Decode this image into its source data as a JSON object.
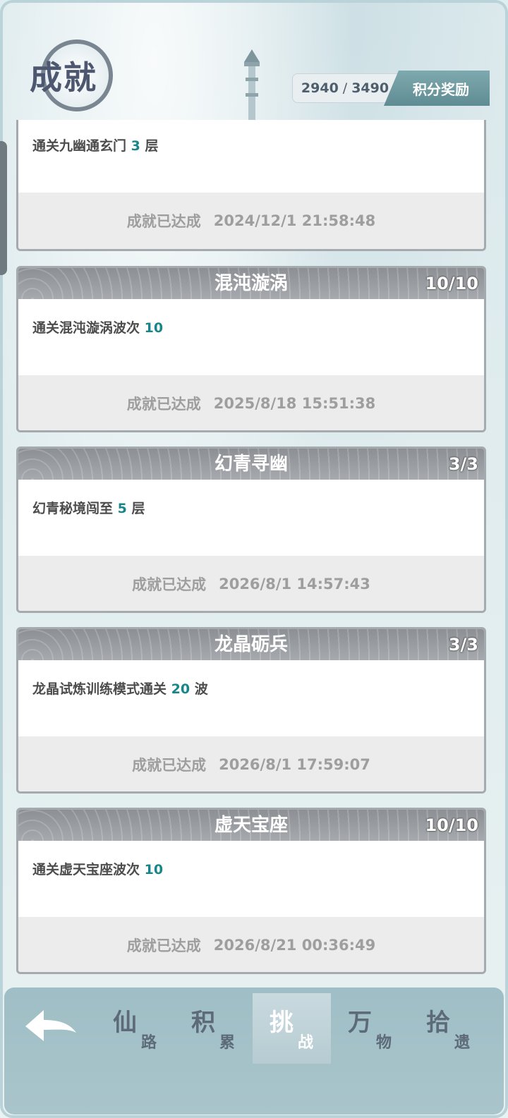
{
  "header": {
    "title": "成就",
    "score_current": "2940",
    "score_sep": "/",
    "score_total": "3490",
    "reward_label": "积分奖励"
  },
  "cards": [
    {
      "title": "",
      "count": "",
      "desc_prefix": "通关九幽通玄门 ",
      "desc_num": "3",
      "desc_suffix": " 层",
      "status": "成就已达成",
      "time": "2024/12/1 21:58:48"
    },
    {
      "title": "混沌漩涡",
      "count": "10/10",
      "desc_prefix": "通关混沌漩涡波次 ",
      "desc_num": "10",
      "desc_suffix": "",
      "status": "成就已达成",
      "time": "2025/8/18 15:51:38"
    },
    {
      "title": "幻青寻幽",
      "count": "3/3",
      "desc_prefix": "幻青秘境闯至 ",
      "desc_num": "5",
      "desc_suffix": " 层",
      "status": "成就已达成",
      "time": "2026/8/1 14:57:43"
    },
    {
      "title": "龙晶砺兵",
      "count": "3/3",
      "desc_prefix": "龙晶试炼训练模式通关 ",
      "desc_num": "20",
      "desc_suffix": " 波",
      "status": "成就已达成",
      "time": "2026/8/1 17:59:07"
    },
    {
      "title": "虚天宝座",
      "count": "10/10",
      "desc_prefix": "通关虚天宝座波次 ",
      "desc_num": "10",
      "desc_suffix": "",
      "status": "成就已达成",
      "time": "2026/8/21 00:36:49"
    }
  ],
  "nav": {
    "back_icon": "back-arrow-icon",
    "tabs": [
      {
        "big": "仙",
        "small": "路"
      },
      {
        "big": "积",
        "small": "累"
      },
      {
        "big": "挑",
        "small": "战"
      },
      {
        "big": "万",
        "small": "物"
      },
      {
        "big": "拾",
        "small": "遗"
      }
    ]
  }
}
